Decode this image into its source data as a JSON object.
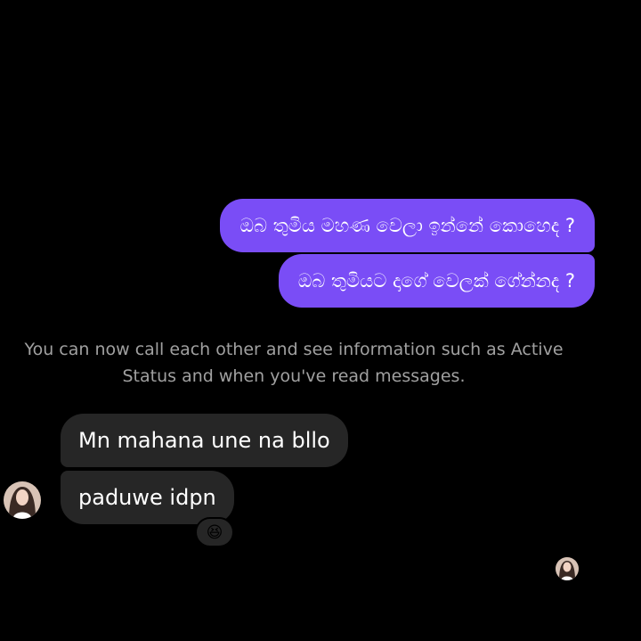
{
  "conversation": {
    "outgoing": [
      "ඔබ තුමිය මහණ වෙලා ඉන්නේ කොහෙද ?",
      "ඔබ තුමියට දාගේ වෙලක් ගේන්නද ?"
    ],
    "system_note": "You can now call each other and see information such as Active Status and when you've read messages.",
    "incoming": [
      "Mn mahana une na bllo",
      "paduwe idpn"
    ],
    "reaction_emoji": "😆",
    "reaction_icon": "grinning-squinting-face-icon"
  },
  "colors": {
    "background": "#000000",
    "outgoing_bubble": "#7a4df6",
    "incoming_bubble": "#262626",
    "system_text": "#a0a0a0"
  }
}
